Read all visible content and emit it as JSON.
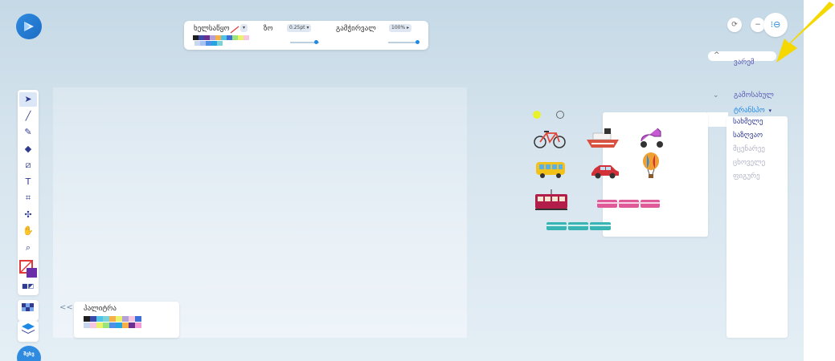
{
  "toolbar": {
    "brush_label": "ხელსაწყო",
    "line_label": "ზო",
    "line_value": "0.25pt",
    "opacity_label": "გამჭირვალ",
    "opacity_value": "100%",
    "brush_colors": [
      "#1f1f1f",
      "#3b4aa8",
      "#6a2f8f",
      "#b3a0d6",
      "#f5b04a",
      "#4fc3e8",
      "#3d6fd6",
      "#9be37a",
      "#e8f26b",
      "#f7c6e0",
      "#c8d6f0",
      "#a9c2f5",
      "#4f8fe6",
      "#26a4e0",
      "#7bd3d9"
    ],
    "line_slider_pct": 0.9,
    "opacity_slider_pct": 1.0
  },
  "colors": {
    "accent": "#1e88e5",
    "tool_icon": "#2f3a8f",
    "category_text": "#5b5bb5",
    "active_category": "#1e88e5",
    "disabled_category": "#b5b5c8",
    "annotation_arrow": "#f5d800"
  },
  "tools": [
    {
      "name": "select",
      "icon": "pointer-icon",
      "glyph": "➤",
      "active": true
    },
    {
      "name": "brush",
      "icon": "brush-icon",
      "glyph": "╱"
    },
    {
      "name": "pencil",
      "icon": "pencil-icon",
      "glyph": "✎"
    },
    {
      "name": "eraser",
      "icon": "eraser-icon",
      "glyph": "◆"
    },
    {
      "name": "fill",
      "icon": "fill-icon",
      "glyph": "⧄"
    },
    {
      "name": "text",
      "icon": "text-icon",
      "glyph": "T"
    },
    {
      "name": "crop",
      "icon": "crop-icon",
      "glyph": "⌗"
    },
    {
      "name": "shrink",
      "icon": "shrink-icon",
      "glyph": "✣"
    },
    {
      "name": "hand",
      "icon": "hand-icon",
      "glyph": "✋"
    },
    {
      "name": "zoom",
      "icon": "zoom-icon",
      "glyph": "⌕"
    }
  ],
  "palette": {
    "collapse": "<<",
    "title": "პალიტრა",
    "colors": [
      "#1f1f1f",
      "#3b4aa8",
      "#4fc3e8",
      "#7bd3d9",
      "#f5b04a",
      "#e8f26b",
      "#b3a0d6",
      "#f7c6e0",
      "#3d6fd6",
      "#c8d6f0",
      "#f7c6e0",
      "#e8f26b",
      "#9be37a",
      "#4f8fe6",
      "#26a4e0",
      "#f5b04a",
      "#6a2f8f",
      "#f59ad6"
    ]
  },
  "user": {
    "badge": "შესვ"
  },
  "categories": {
    "toggle_top": "^",
    "background": "ვარემ",
    "toggle_mid": "⌄",
    "decoration": "გამოსახულ",
    "transport": "ტრანსპო",
    "transport_arrow": "▾",
    "sub_items": [
      {
        "label": "სახმელე",
        "state": "normal"
      },
      {
        "label": "საზღვაო",
        "state": "normal"
      },
      {
        "label": "მცენარეე",
        "state": "disabled"
      },
      {
        "label": "ცხოველე",
        "state": "disabled"
      },
      {
        "label": "ფიგურე",
        "state": "disabled"
      }
    ]
  },
  "stickers": [
    {
      "name": "bicycle"
    },
    {
      "name": "boat"
    },
    {
      "name": "scooter"
    },
    {
      "name": "bus"
    },
    {
      "name": "car"
    },
    {
      "name": "hot-air-balloon"
    },
    {
      "name": "tram"
    },
    {
      "name": "pink-train"
    },
    {
      "name": "teal-train"
    }
  ]
}
